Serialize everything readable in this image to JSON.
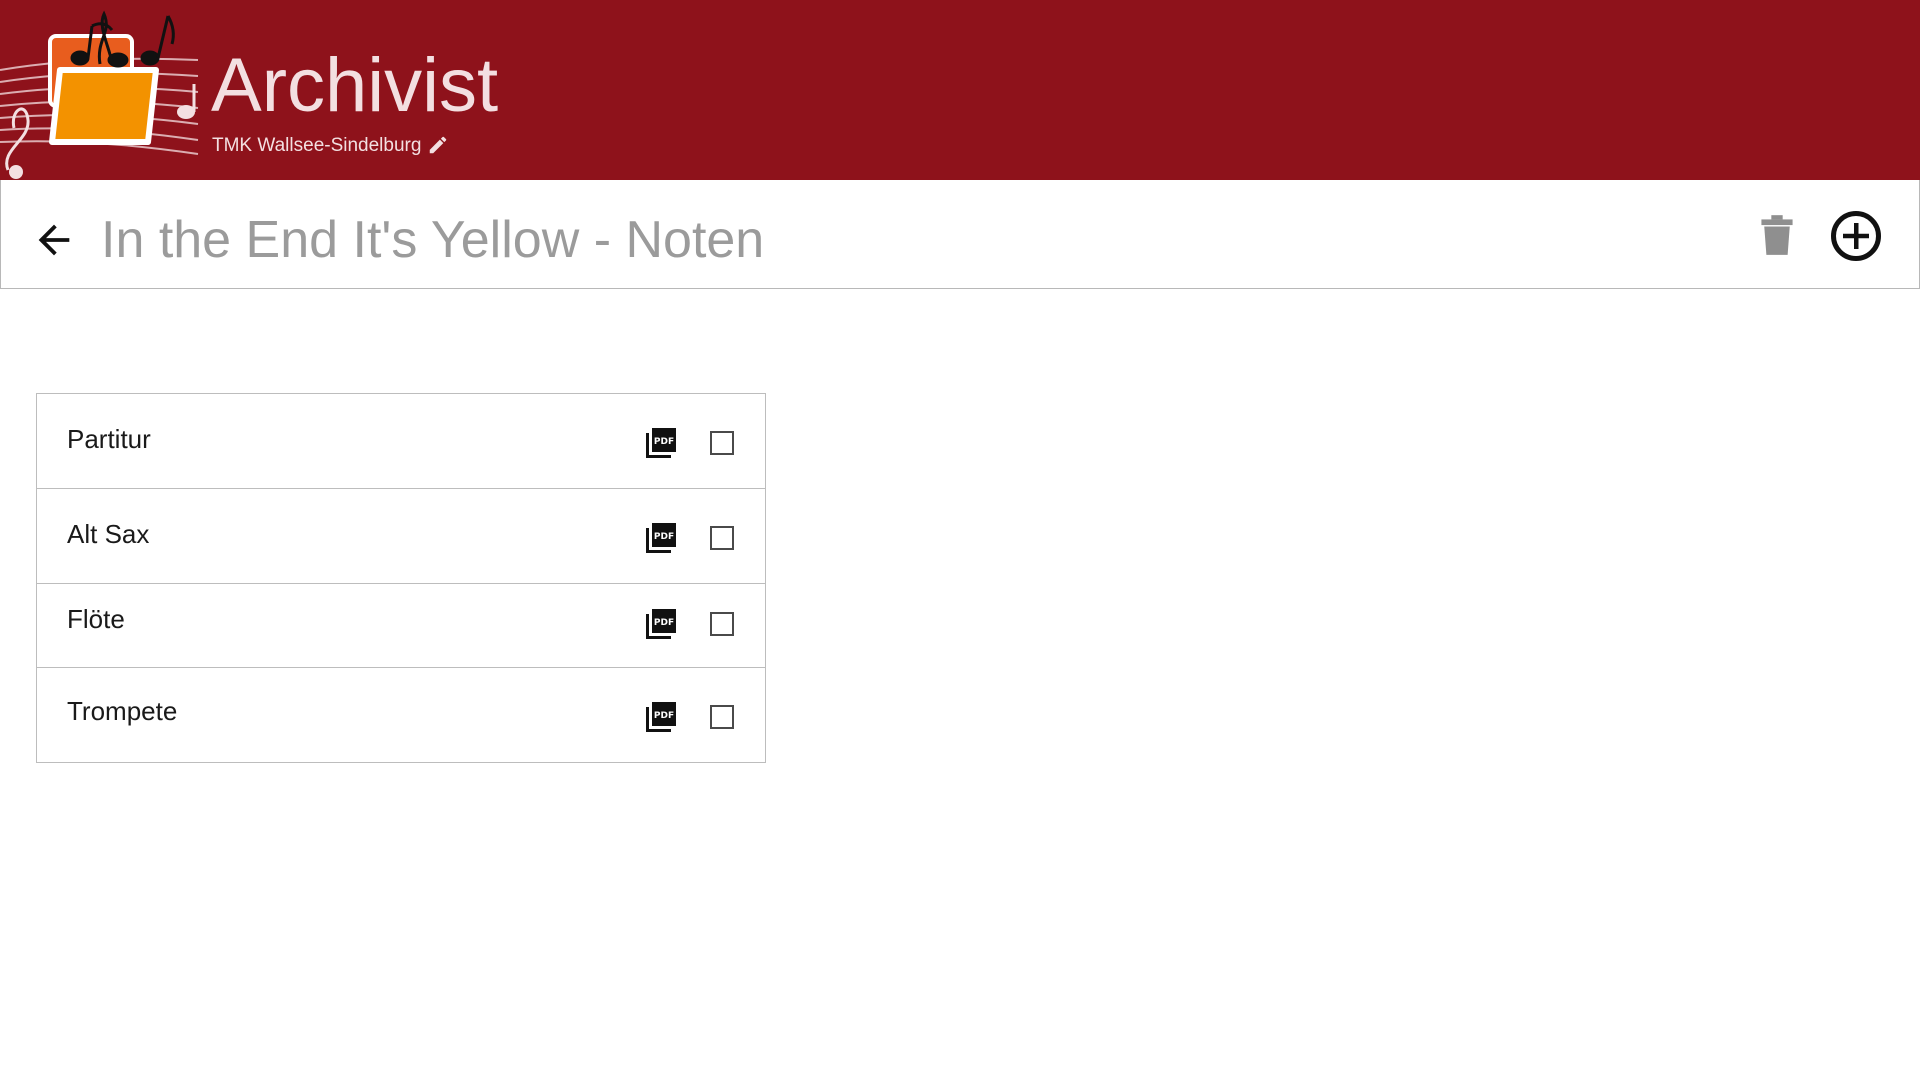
{
  "app": {
    "title": "Archivist",
    "organization": "TMK Wallsee-Sindelburg",
    "brand_color": "#8e121b",
    "logo_folder_color": "#f39200"
  },
  "toolbar": {
    "page_title": "In the End It's Yellow - Noten",
    "back_icon": "arrow-left-icon",
    "delete_icon": "trash-icon",
    "add_icon": "plus-circle-icon"
  },
  "parts": [
    {
      "label": "Partitur",
      "file_icon": "pdf-icon",
      "checked": false
    },
    {
      "label": "Alt Sax",
      "file_icon": "pdf-icon",
      "checked": false
    },
    {
      "label": "Flöte",
      "file_icon": "pdf-icon",
      "checked": false
    },
    {
      "label": "Trompete",
      "file_icon": "pdf-icon",
      "checked": false
    }
  ]
}
